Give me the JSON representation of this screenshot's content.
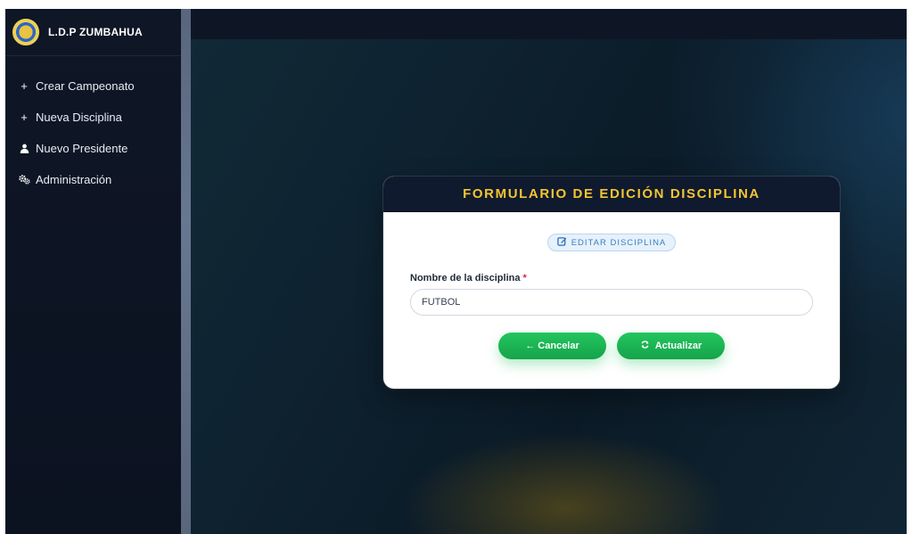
{
  "sidebar": {
    "brand": "L.D.P ZUMBAHUA",
    "items": [
      {
        "icon": "plus-icon",
        "glyph": "+",
        "label": "Crear Campeonato"
      },
      {
        "icon": "plus-icon",
        "glyph": "+",
        "label": "Nueva Disciplina"
      },
      {
        "icon": "user-tie-icon",
        "glyph": "👤",
        "label": "Nuevo Presidente"
      },
      {
        "icon": "gears-icon",
        "glyph": "⚙",
        "label": "Administración"
      }
    ]
  },
  "card": {
    "title": "FORMULARIO DE EDICIÓN DISCIPLINA",
    "badge": "EDITAR DISCIPLINA",
    "badge_icon": "edit-icon",
    "field_label": "Nombre de la disciplina",
    "required_mark": "*",
    "field_value": "FUTBOL",
    "cancel_label": "← Cancelar",
    "update_label": "Actualizar",
    "update_icon": "refresh-icon"
  },
  "colors": {
    "accent_gold": "#f4c532",
    "button_green": "#22c55e",
    "sidebar_bg": "#0f1626"
  }
}
